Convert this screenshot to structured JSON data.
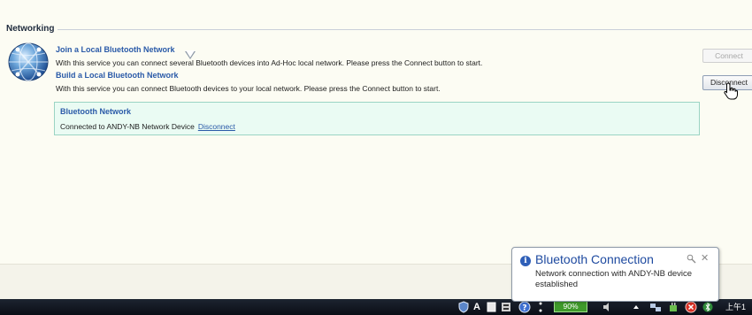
{
  "section": {
    "title": "Networking"
  },
  "options": [
    {
      "title": "Join a Local Bluetooth Network",
      "description": "With this service you can connect several Bluetooth devices into Ad-Hoc local network. Please press the Connect button to start."
    },
    {
      "title": "Build a Local Bluetooth Network",
      "description": "With this service you can connect Bluetooth devices to your local network. Please press the Connect button to start."
    }
  ],
  "buttons": {
    "connect": "Connect",
    "disconnect": "Disconnect"
  },
  "network_box": {
    "title": "Bluetooth Network",
    "status": "Connected to ANDY-NB Network Device",
    "link": "Disconnect"
  },
  "balloon": {
    "title": "Bluetooth Connection",
    "body": "Network connection with ANDY-NB device established"
  },
  "taskbar": {
    "language": "A",
    "battery": "90%",
    "clock": "上午1"
  },
  "icons": {
    "section": "bluetooth-globe-icon",
    "notification": "info-icon"
  },
  "colors": {
    "link": "#2a5aa8",
    "panel_bg": "#fcfcf3",
    "network_box_bg": "#eafbf3",
    "balloon_title": "#1e4aa0",
    "battery": "#3f9a2b"
  }
}
